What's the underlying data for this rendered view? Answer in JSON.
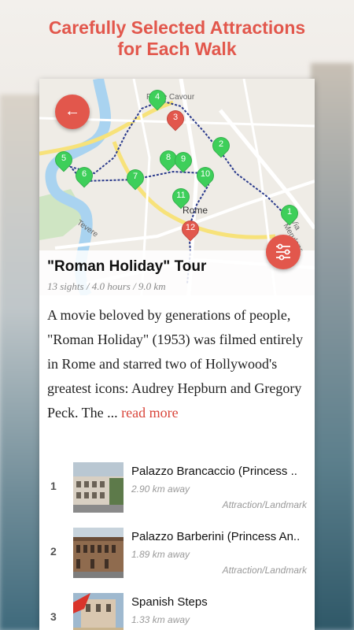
{
  "headline": {
    "line1": "Carefully Selected Attractions",
    "line2": "for Each Walk"
  },
  "colors": {
    "accent": "#e2574c",
    "pin_green": "#3ecf5a",
    "pin_red": "#e2574c"
  },
  "map": {
    "labels": {
      "city": "Rome",
      "river": "Tevere",
      "area1": "Ponte Cavour",
      "street": "Via Merulana"
    },
    "pins": [
      {
        "num": "1",
        "color": "green"
      },
      {
        "num": "2",
        "color": "green"
      },
      {
        "num": "3",
        "color": "red"
      },
      {
        "num": "4",
        "color": "green"
      },
      {
        "num": "5",
        "color": "green"
      },
      {
        "num": "6",
        "color": "green"
      },
      {
        "num": "7",
        "color": "green"
      },
      {
        "num": "8",
        "color": "green"
      },
      {
        "num": "9",
        "color": "green"
      },
      {
        "num": "10",
        "color": "green"
      },
      {
        "num": "11",
        "color": "green"
      },
      {
        "num": "12",
        "color": "red"
      }
    ],
    "back_icon": "arrow-left-icon",
    "filter_icon": "sliders-icon"
  },
  "tour": {
    "title": "\"Roman Holiday\" Tour",
    "meta": "13 sights / 4.0 hours / 9.0 km",
    "description": "A movie beloved by generations of people, \"Roman Holiday\" (1953) was filmed entirely in Rome and starred two of Hollywood's greatest icons: Audrey Hepburn and Gregory Peck. The ... ",
    "read_more": "read more"
  },
  "sights": [
    {
      "index": "1",
      "name": "Palazzo Brancaccio (Princess ..",
      "distance": "2.90 km away",
      "category": "Attraction/Landmark"
    },
    {
      "index": "2",
      "name": "Palazzo Barberini (Princess An..",
      "distance": "1.89 km away",
      "category": "Attraction/Landmark"
    },
    {
      "index": "3",
      "name": "Spanish Steps",
      "distance": "1.33 km away",
      "category": ""
    }
  ]
}
